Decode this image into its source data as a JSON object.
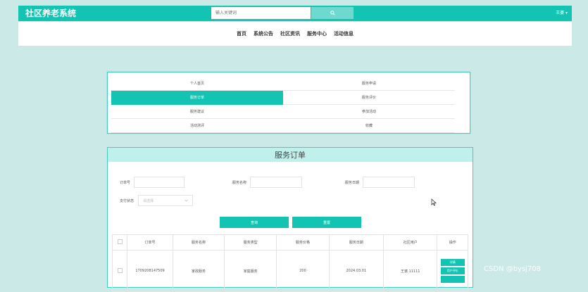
{
  "app": {
    "title": "社区养老系统",
    "user": "王婆 ▾"
  },
  "search": {
    "placeholder": "输入关键词",
    "icon": "search-icon"
  },
  "nav": {
    "items": [
      "首页",
      "系统公告",
      "社区资讯",
      "服务中心",
      "活动信息"
    ]
  },
  "menu": {
    "items": [
      {
        "label": "个人首页",
        "active": false
      },
      {
        "label": "服务申请",
        "active": false
      },
      {
        "label": "服务订单",
        "active": true
      },
      {
        "label": "服务评价",
        "active": false
      },
      {
        "label": "服务建议",
        "active": false
      },
      {
        "label": "参加活动",
        "active": false
      },
      {
        "label": "活动测评",
        "active": false
      },
      {
        "label": "收藏",
        "active": false
      }
    ]
  },
  "orders": {
    "title": "服务订单",
    "filters": {
      "order_no_label": "订单号",
      "service_name_label": "服务名称",
      "service_date_label": "服务日期",
      "pay_status_label": "支付状态",
      "pay_status_placeholder": "请选择"
    },
    "buttons": {
      "query": "查询",
      "reset": "重置"
    },
    "columns": [
      "订单号",
      "服务名称",
      "服务类型",
      "服务价格",
      "服务日期",
      "社区用户",
      "操作"
    ],
    "rows": [
      {
        "order_no": "1709208147509",
        "service_name": "家政服务",
        "service_type": "家庭服务",
        "price": "200",
        "date": "2024.03.01",
        "user": "王婆 11111",
        "actions": [
          "详情",
          "用户评价",
          ""
        ]
      }
    ]
  },
  "watermark": "CSDN @bysj708",
  "colors": {
    "primary": "#14c4b3",
    "page_bg": "#cbe9e6",
    "header_tint": "#bff0eb"
  }
}
